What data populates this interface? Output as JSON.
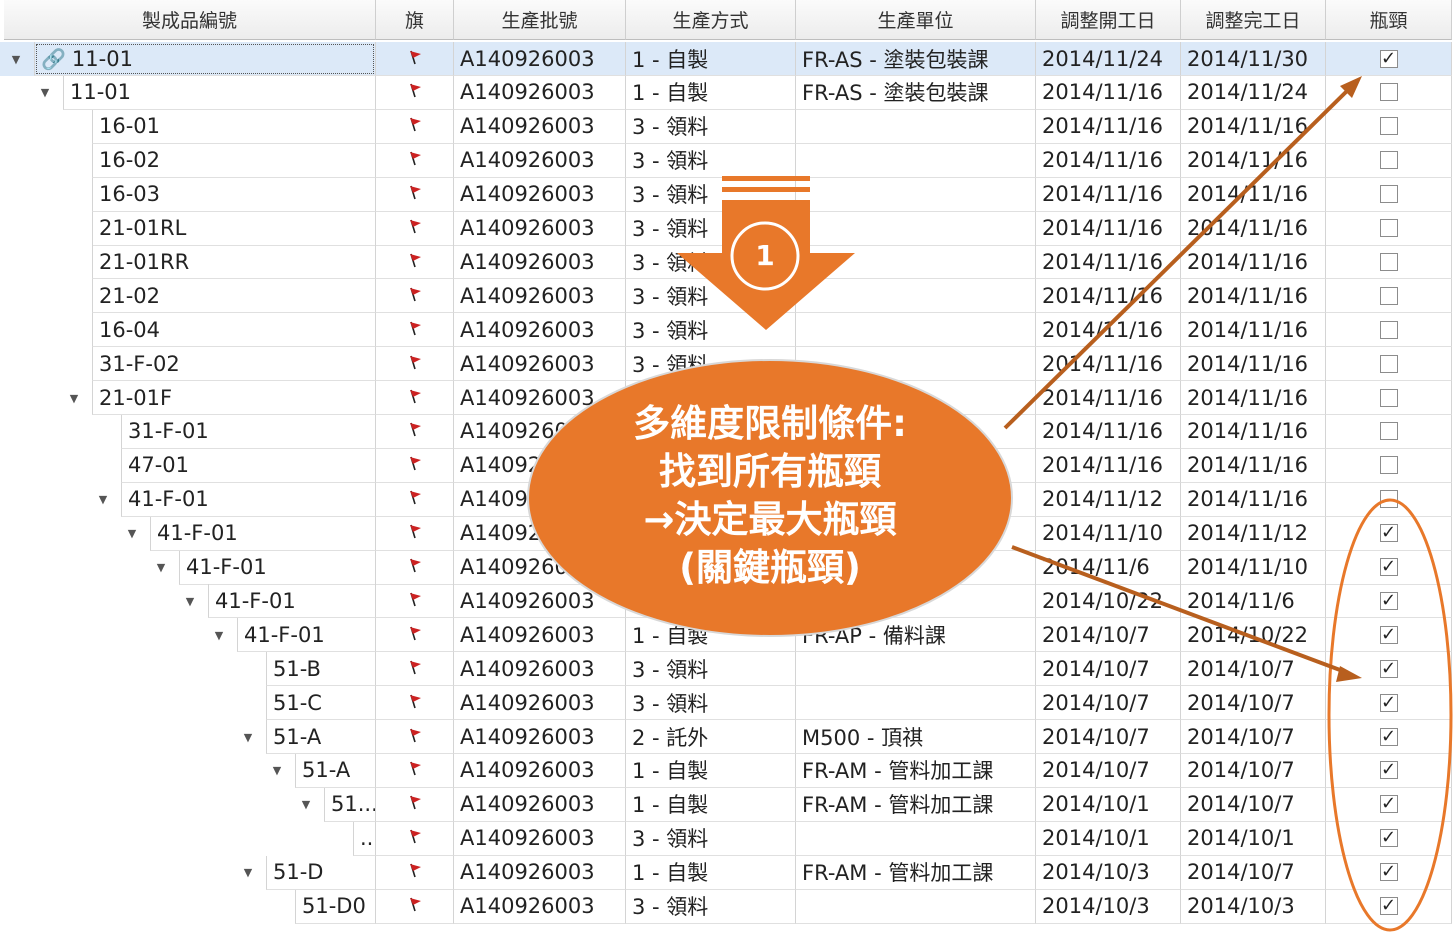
{
  "columns": [
    "製成品編號",
    "旗",
    "生產批號",
    "生產方式",
    "生產單位",
    "調整開工日",
    "調整完工日",
    "瓶頸"
  ],
  "rows": [
    {
      "name": "11-01",
      "batch": "A140926003",
      "method": "1 - 自製",
      "unit": "FR-AS - 塗裝包裝課",
      "start": "2014/11/24",
      "end": "2014/11/30",
      "bottleneck": true
    },
    {
      "name": "11-01",
      "batch": "A140926003",
      "method": "1 - 自製",
      "unit": "FR-AS - 塗裝包裝課",
      "start": "2014/11/16",
      "end": "2014/11/24",
      "bottleneck": false
    },
    {
      "name": "16-01",
      "batch": "A140926003",
      "method": "3 - 領料",
      "unit": "",
      "start": "2014/11/16",
      "end": "2014/11/16",
      "bottleneck": false
    },
    {
      "name": "16-02",
      "batch": "A140926003",
      "method": "3 - 領料",
      "unit": "",
      "start": "2014/11/16",
      "end": "2014/11/16",
      "bottleneck": false
    },
    {
      "name": "16-03",
      "batch": "A140926003",
      "method": "3 - 領料",
      "unit": "",
      "start": "2014/11/16",
      "end": "2014/11/16",
      "bottleneck": false
    },
    {
      "name": "21-01RL",
      "batch": "A140926003",
      "method": "3 - 領料",
      "unit": "",
      "start": "2014/11/16",
      "end": "2014/11/16",
      "bottleneck": false
    },
    {
      "name": "21-01RR",
      "batch": "A140926003",
      "method": "3 - 領料",
      "unit": "",
      "start": "2014/11/16",
      "end": "2014/11/16",
      "bottleneck": false
    },
    {
      "name": "21-02",
      "batch": "A140926003",
      "method": "3 - 領料",
      "unit": "",
      "start": "2014/11/16",
      "end": "2014/11/16",
      "bottleneck": false
    },
    {
      "name": "16-04",
      "batch": "A140926003",
      "method": "3 - 領料",
      "unit": "",
      "start": "2014/11/16",
      "end": "2014/11/16",
      "bottleneck": false
    },
    {
      "name": "31-F-02",
      "batch": "A140926003",
      "method": "3 - 領料",
      "unit": "",
      "start": "2014/11/16",
      "end": "2014/11/16",
      "bottleneck": false
    },
    {
      "name": "21-01F",
      "batch": "A140926003",
      "method": "",
      "unit": "",
      "start": "2014/11/16",
      "end": "2014/11/16",
      "bottleneck": false
    },
    {
      "name": "31-F-01",
      "batch": "A140926003",
      "method": "",
      "unit": "",
      "start": "2014/11/16",
      "end": "2014/11/16",
      "bottleneck": false
    },
    {
      "name": "47-01",
      "batch": "A140926003",
      "method": "",
      "unit": "",
      "start": "2014/11/16",
      "end": "2014/11/16",
      "bottleneck": false
    },
    {
      "name": "41-F-01",
      "batch": "A140926003",
      "method": "",
      "unit": "",
      "start": "2014/11/12",
      "end": "2014/11/16",
      "bottleneck": false
    },
    {
      "name": "41-F-01",
      "batch": "A140926003",
      "method": "",
      "unit": "",
      "start": "2014/11/10",
      "end": "2014/11/12",
      "bottleneck": true
    },
    {
      "name": "41-F-01",
      "batch": "A140926003",
      "method": "",
      "unit": "",
      "start": "2014/11/6",
      "end": "2014/11/10",
      "bottleneck": true
    },
    {
      "name": "41-F-01",
      "batch": "A140926003",
      "method": "",
      "unit": "",
      "start": "2014/10/22",
      "end": "2014/11/6",
      "bottleneck": true
    },
    {
      "name": "41-F-01",
      "batch": "A140926003",
      "method": "1 - 自製",
      "unit": "FR-AP - 備料課",
      "start": "2014/10/7",
      "end": "2014/10/22",
      "bottleneck": true
    },
    {
      "name": "51-B",
      "batch": "A140926003",
      "method": "3 - 領料",
      "unit": "",
      "start": "2014/10/7",
      "end": "2014/10/7",
      "bottleneck": true
    },
    {
      "name": "51-C",
      "batch": "A140926003",
      "method": "3 - 領料",
      "unit": "",
      "start": "2014/10/7",
      "end": "2014/10/7",
      "bottleneck": true
    },
    {
      "name": "51-A",
      "batch": "A140926003",
      "method": "2 - 託外",
      "unit": "M500 - 頂祺",
      "start": "2014/10/7",
      "end": "2014/10/7",
      "bottleneck": true
    },
    {
      "name": "51-A",
      "batch": "A140926003",
      "method": "1 - 自製",
      "unit": "FR-AM - 管料加工課",
      "start": "2014/10/7",
      "end": "2014/10/7",
      "bottleneck": true
    },
    {
      "name": "51...",
      "batch": "A140926003",
      "method": "1 - 自製",
      "unit": "FR-AM - 管料加工課",
      "start": "2014/10/1",
      "end": "2014/10/7",
      "bottleneck": true
    },
    {
      "name": "...",
      "batch": "A140926003",
      "method": "3 - 領料",
      "unit": "",
      "start": "2014/10/1",
      "end": "2014/10/1",
      "bottleneck": true
    },
    {
      "name": "51-D",
      "batch": "A140926003",
      "method": "1 - 自製",
      "unit": "FR-AM - 管料加工課",
      "start": "2014/10/3",
      "end": "2014/10/7",
      "bottleneck": true
    },
    {
      "name": "51-D0",
      "batch": "A140926003",
      "method": "3 - 領料",
      "unit": "",
      "start": "2014/10/3",
      "end": "2014/10/3",
      "bottleneck": true
    }
  ],
  "callout": {
    "step": "1",
    "lines": [
      "多維度限制條件:",
      "找到所有瓶頸",
      "→決定最大瓶頸",
      "(關鍵瓶頸)"
    ]
  },
  "colors": {
    "accent": "#E8782A",
    "flag": "#CC2222",
    "selection": "#DCE9F8"
  },
  "icons": {
    "flag": "flag-icon",
    "expand": "chevron-down-icon",
    "link": "link-icon",
    "check": "checkbox"
  }
}
